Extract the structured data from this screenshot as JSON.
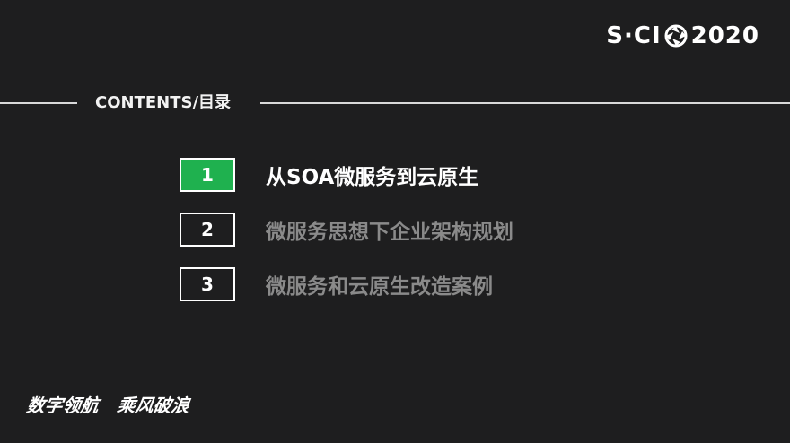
{
  "logo": {
    "prefix": "S·CI",
    "year": "2020",
    "mark_icon": "aperture-icon"
  },
  "header": {
    "title": "CONTENTS/目录"
  },
  "menu": {
    "items": [
      {
        "number": "1",
        "label": "从SOA微服务到云原生",
        "active": true
      },
      {
        "number": "2",
        "label": "微服务思想下企业架构规划",
        "active": false
      },
      {
        "number": "3",
        "label": "微服务和云原生改造案例",
        "active": false
      }
    ]
  },
  "slogan": {
    "part1": "数字领航",
    "part2": "乘风破浪"
  },
  "colors": {
    "background": "#1e1e1f",
    "accent": "#1fb14f",
    "inactive_text": "#8a8a8a"
  }
}
